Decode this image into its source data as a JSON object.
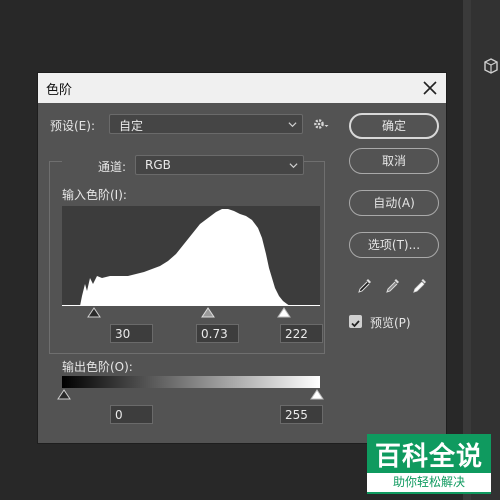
{
  "dialog": {
    "title": "色阶",
    "preset_label": "预设(E):",
    "preset_value": "自定",
    "channel_label": "通道:",
    "channel_value": "RGB",
    "input_levels_label": "输入色阶(I):",
    "input_black": "30",
    "input_gamma": "0.73",
    "input_white": "222",
    "output_levels_label": "输出色阶(O):",
    "output_black": "0",
    "output_white": "255"
  },
  "buttons": {
    "ok": "确定",
    "cancel": "取消",
    "auto": "自动(A)",
    "options": "选项(T)..."
  },
  "preview": {
    "label": "预览(P)",
    "checked": true
  },
  "icons": [
    "close-icon",
    "chevron-down-icon",
    "gear-icon",
    "eyedropper-black-icon",
    "eyedropper-gray-icon",
    "eyedropper-white-icon",
    "checkbox-checked-icon"
  ],
  "colors": {
    "dialog_bg": "#535353",
    "workspace_bg": "#282828",
    "titlebar_bg": "#f0f0f0",
    "watermark_green": "#0f9a5f"
  },
  "watermark": {
    "main": "百科全说",
    "sub": "助你轻松解决"
  }
}
